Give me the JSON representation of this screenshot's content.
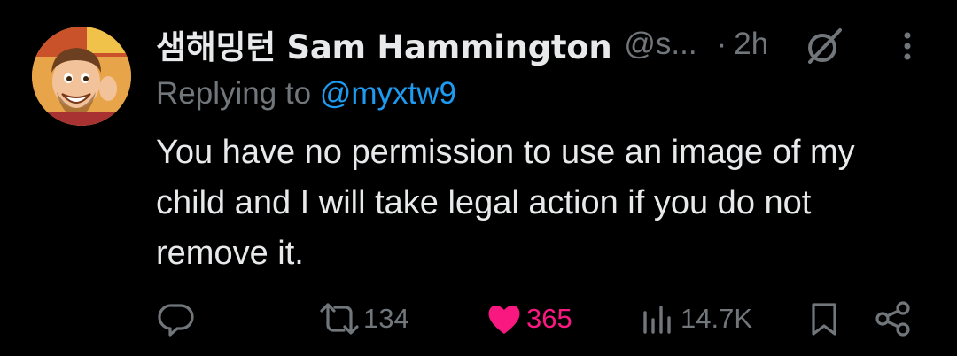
{
  "tweet": {
    "author": {
      "display_name": "샘해밍턴 Sam Hammington",
      "handle": "@s...",
      "avatar": "cartoon-avatar"
    },
    "separator": "·",
    "time": "2h",
    "replying_prefix": "Replying to ",
    "replying_to": "@myxtw9",
    "text": "You have no permission to use an image of my child and I will take legal action if you do not remove it.",
    "actions": {
      "reply": {
        "icon": "reply-icon",
        "count": ""
      },
      "retweet": {
        "icon": "retweet-icon",
        "count": "134"
      },
      "like": {
        "icon": "heart-icon",
        "count": "365",
        "active": true
      },
      "views": {
        "icon": "views-icon",
        "count": "14.7K"
      },
      "bookmark": {
        "icon": "bookmark-icon"
      },
      "share": {
        "icon": "share-icon"
      }
    }
  },
  "colors": {
    "background": "#000000",
    "text": "#e7e9ea",
    "muted": "#71767b",
    "link": "#1d9bf0",
    "like": "#f91880"
  }
}
